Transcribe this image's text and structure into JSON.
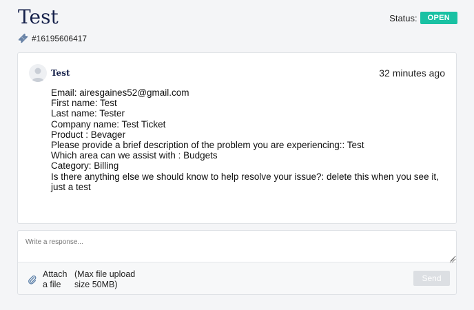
{
  "ticket": {
    "title": "Test",
    "id": "#16195606417",
    "status_label": "Status:",
    "status_value": "OPEN"
  },
  "message": {
    "author": "Test",
    "timestamp": "32 minutes ago",
    "lines": [
      "Email: airesgaines52@gmail.com",
      "First name: Test",
      "Last name: Tester",
      "Company name: Test Ticket",
      "Product : Bevager",
      "Please provide a brief description of the problem you are experiencing:: Test",
      "Which area can we assist with : Budgets",
      "Category: Billing",
      "Is there anything else we should know to help resolve your issue?: delete this when you see it, just a test"
    ]
  },
  "reply": {
    "placeholder": "Write a response...",
    "attach_label": "Attach a file",
    "attach_note": "(Max file upload size 50MB)",
    "send_label": "Send"
  },
  "colors": {
    "status_badge": "#19c1a3",
    "title": "#15204a",
    "send_disabled": "#dcdfe3"
  },
  "icons": {
    "ticket": "ticket-icon",
    "avatar": "user-avatar-icon",
    "attach": "paperclip-icon"
  }
}
